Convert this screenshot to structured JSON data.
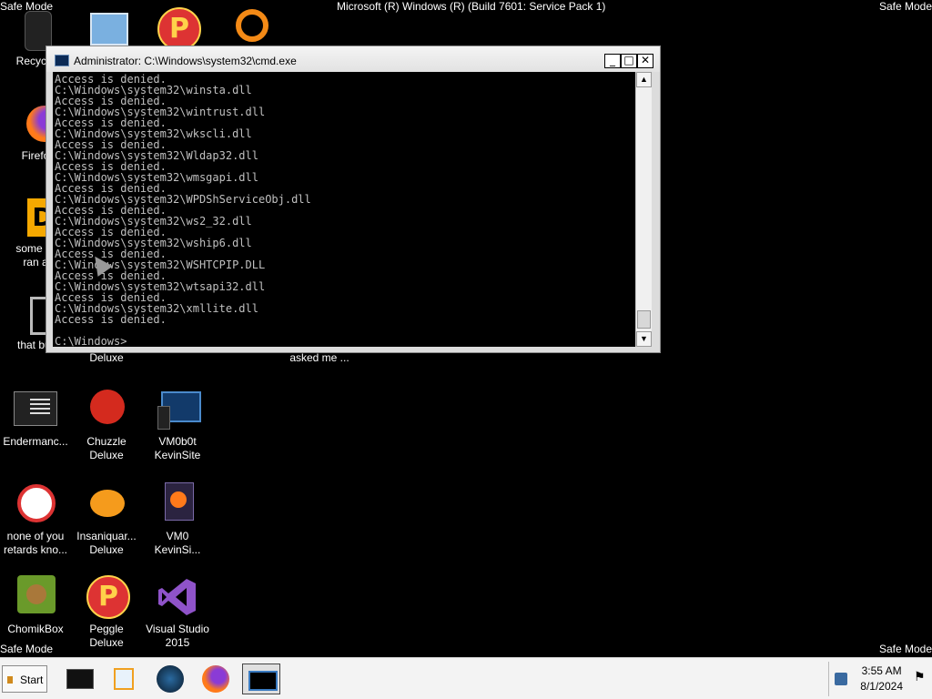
{
  "top_bar": {
    "safe_mode_left": "Safe Mode",
    "build": "Microsoft (R) Windows (R) (Build 7601: Service Pack 1)",
    "safe_mode_right": "Safe Mode"
  },
  "bottom_bar": {
    "safe_mode_left": "Safe Mode",
    "safe_mode_right": "Safe Mode"
  },
  "desktop_icons": {
    "recycle": "Recycle",
    "firefox": "Firefo",
    "some_run_1": "some ru",
    "some_run_2": "ran a",
    "that_but": "that but",
    "deluxe": "Deluxe",
    "asked_me": "asked me ...",
    "enderman": "Endermanc...",
    "chuzzle_1": "Chuzzle",
    "chuzzle_2": "Deluxe",
    "vm0b0t_1": "VM0b0t",
    "vm0b0t_2": "KevinSite",
    "none_1": "none of you",
    "none_2": "retards kno...",
    "insaniquarium_1": "Insaniquar...",
    "insaniquarium_2": "Deluxe",
    "vm0_1": "VM0",
    "vm0_2": "KevinSi...",
    "chomik": "ChomikBox",
    "peggle": "Peggle Deluxe",
    "vs_1": "Visual Studio",
    "vs_2": "2015"
  },
  "cmd_window": {
    "title": "Administrator: C:\\Windows\\system32\\cmd.exe",
    "lines": [
      "Access is denied.",
      "C:\\Windows\\system32\\winsta.dll",
      "Access is denied.",
      "C:\\Windows\\system32\\wintrust.dll",
      "Access is denied.",
      "C:\\Windows\\system32\\wkscli.dll",
      "Access is denied.",
      "C:\\Windows\\system32\\Wldap32.dll",
      "Access is denied.",
      "C:\\Windows\\system32\\wmsgapi.dll",
      "Access is denied.",
      "C:\\Windows\\system32\\WPDShServiceObj.dll",
      "Access is denied.",
      "C:\\Windows\\system32\\ws2_32.dll",
      "Access is denied.",
      "C:\\Windows\\system32\\wship6.dll",
      "Access is denied.",
      "C:\\Windows\\system32\\WSHTCPIP.DLL",
      "Access is denied.",
      "C:\\Windows\\system32\\wtsapi32.dll",
      "Access is denied.",
      "C:\\Windows\\system32\\xmllite.dll",
      "Access is denied.",
      "",
      "C:\\Windows>"
    ]
  },
  "taskbar": {
    "start_label": "Start",
    "time": "3:55 AM",
    "date": "8/1/2024"
  }
}
